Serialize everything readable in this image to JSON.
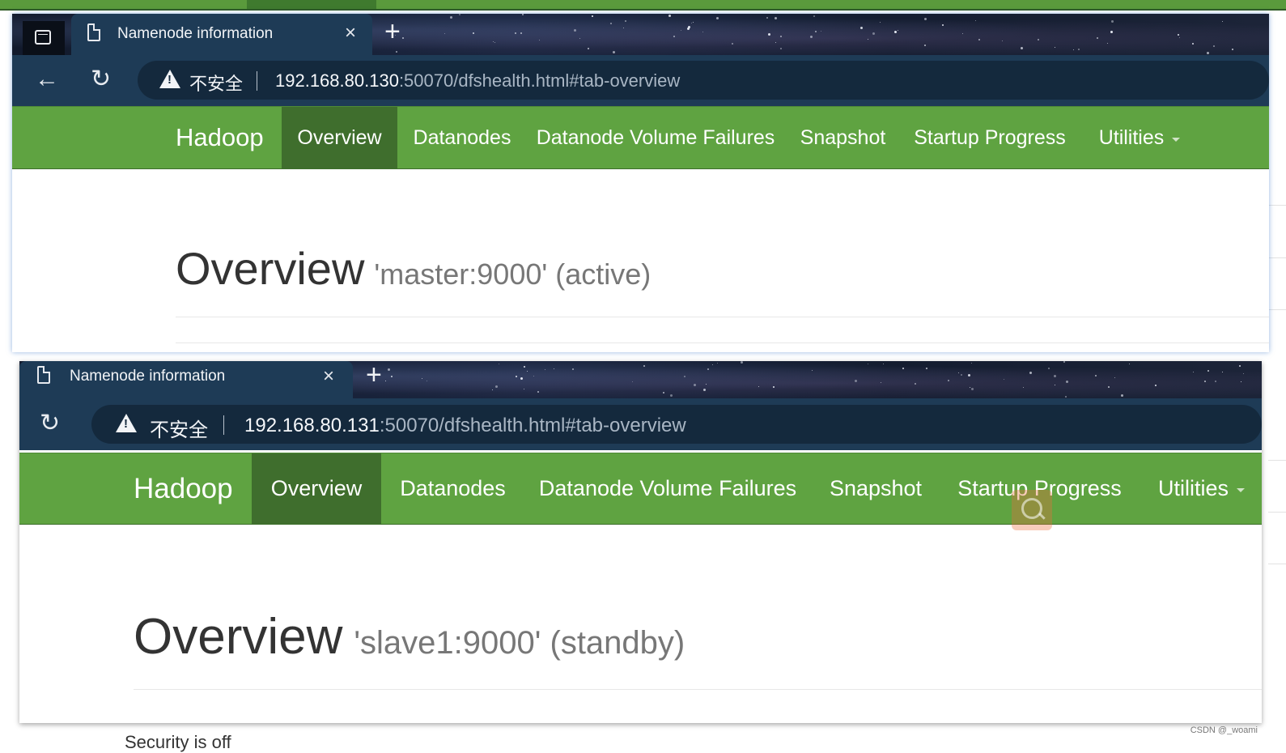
{
  "windows": [
    {
      "tab": {
        "title": "Namenode information",
        "close": "×",
        "new_tab": "+"
      },
      "url": {
        "warning": "不安全",
        "host": "192.168.80.130",
        "rest": ":50070/dfshealth.html#tab-overview"
      },
      "nav": {
        "brand": "Hadoop",
        "items": [
          "Overview",
          "Datanodes",
          "Datanode Volume Failures",
          "Snapshot",
          "Startup Progress",
          "Utilities"
        ],
        "active": "Overview"
      },
      "header": {
        "title": "Overview",
        "subtitle": "'master:9000' (active)"
      }
    },
    {
      "tab": {
        "title": "Namenode information",
        "close": "×",
        "new_tab": "+"
      },
      "url": {
        "warning": "不安全",
        "host": "192.168.80.131",
        "rest": ":50070/dfshealth.html#tab-overview"
      },
      "nav": {
        "brand": "Hadoop",
        "items": [
          "Overview",
          "Datanodes",
          "Datanode Volume Failures",
          "Snapshot",
          "Startup Progress",
          "Utilities"
        ],
        "active": "Overview"
      },
      "header": {
        "title": "Overview",
        "subtitle": "'slave1:9000' (standby)"
      }
    }
  ],
  "footer": {
    "security": "Security is off"
  },
  "watermark": "CSDN @_woami",
  "icons": [
    "vertical-tabs-icon",
    "document-icon",
    "close-icon",
    "new-tab-icon",
    "back-arrow-icon",
    "refresh-icon",
    "warning-icon",
    "caret-down-icon",
    "search-icon"
  ],
  "colors": {
    "hadoop_green": "#5fa341",
    "active_tab": "#3f6e2d",
    "browser_chrome": "#1e3b56"
  }
}
